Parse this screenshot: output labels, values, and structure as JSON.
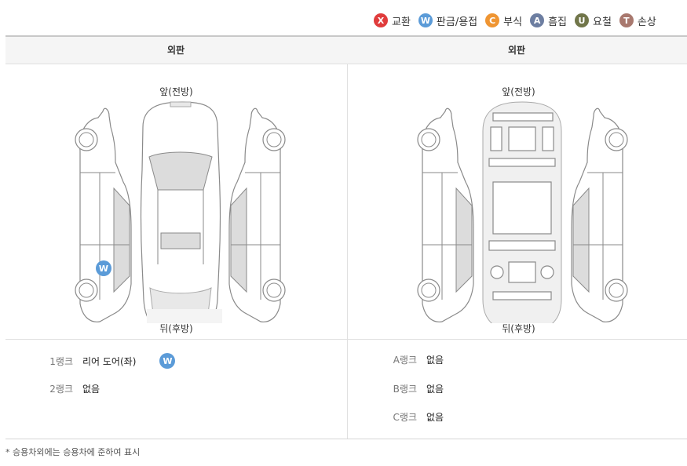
{
  "legend": [
    {
      "code": "X",
      "label": "교환",
      "color": "#e03c3c",
      "icon": "exchange-icon"
    },
    {
      "code": "W",
      "label": "판금/용접",
      "color": "#5b9bd8",
      "icon": "welding-icon"
    },
    {
      "code": "C",
      "label": "부식",
      "color": "#ef9532",
      "icon": "corrosion-icon"
    },
    {
      "code": "A",
      "label": "흠집",
      "color": "#6d7ea1",
      "icon": "scratch-icon"
    },
    {
      "code": "U",
      "label": "요철",
      "color": "#71764a",
      "icon": "dent-icon"
    },
    {
      "code": "T",
      "label": "손상",
      "color": "#a8786e",
      "icon": "damage-icon"
    }
  ],
  "header": {
    "left": "외판",
    "right": "외판"
  },
  "diagram": {
    "front": "앞(전방)",
    "rear": "뒤(후방)"
  },
  "left_marker": {
    "code": "W",
    "color": "#5b9bd8"
  },
  "left_ranks": [
    {
      "label": "1랭크",
      "value": "리어 도어(좌)",
      "badge": "W"
    },
    {
      "label": "2랭크",
      "value": "없음"
    }
  ],
  "right_ranks": [
    {
      "label": "A랭크",
      "value": "없음"
    },
    {
      "label": "B랭크",
      "value": "없음"
    },
    {
      "label": "C랭크",
      "value": "없음"
    }
  ],
  "footnote": "* 승용차외에는 승용차에 준하여 표시"
}
